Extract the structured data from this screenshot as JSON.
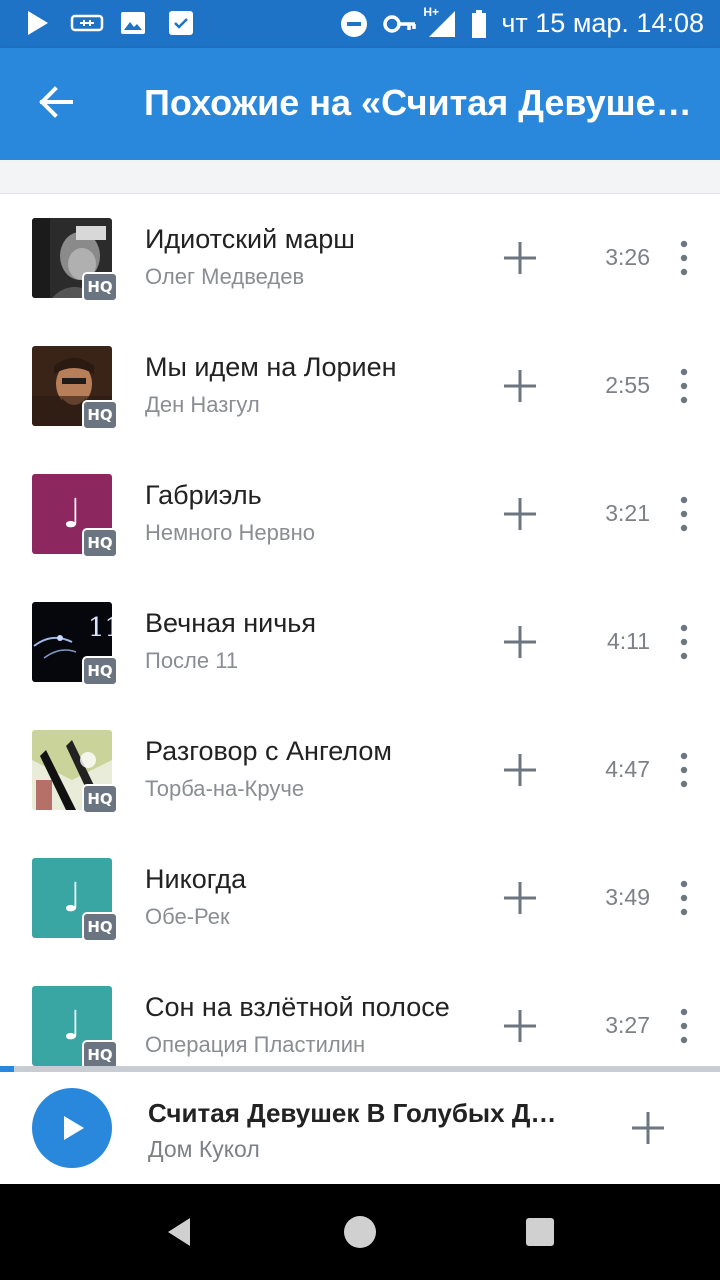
{
  "status_bar": {
    "date_time": "чт 15 мар. 14:08",
    "network": "H+",
    "icons": [
      "play-icon",
      "vpn-icon",
      "image-icon",
      "check-icon",
      "dnd-icon",
      "key-icon",
      "signal-icon",
      "battery-icon"
    ]
  },
  "app_bar": {
    "title": "Похожие на «Считая Девушек В Голубых Джинсах»",
    "back_icon": "back-arrow-icon",
    "background": "#2a88dc"
  },
  "tracks": [
    {
      "title": "Идиотский марш",
      "artist": "Олег Медведев",
      "duration": "3:26",
      "badge": "HQ",
      "cover": "photo"
    },
    {
      "title": "Мы идем на Лориен",
      "artist": "Ден Назгул",
      "duration": "2:55",
      "badge": "HQ",
      "cover": "photo"
    },
    {
      "title": "Габриэль",
      "artist": "Немного Нервно",
      "duration": "3:21",
      "badge": "HQ",
      "cover": "note",
      "cover_color": "#8d2760"
    },
    {
      "title": "Вечная ничья",
      "artist": "После 11",
      "duration": "4:11",
      "badge": "HQ",
      "cover": "photo"
    },
    {
      "title": "Разговор с Ангелом",
      "artist": "Торба-на-Круче",
      "duration": "4:47",
      "badge": "HQ",
      "cover": "photo"
    },
    {
      "title": "Никогда",
      "artist": "Обе-Рек",
      "duration": "3:49",
      "badge": "HQ",
      "cover": "note",
      "cover_color": "#3aa6a3"
    },
    {
      "title": "Сон на взлётной полосе",
      "artist": "Операция Пластилин",
      "duration": "3:27",
      "badge": "HQ",
      "cover": "note",
      "cover_color": "#3aa6a3"
    }
  ],
  "player": {
    "title": "Считая Девушек В Голубых Джинсах",
    "artist": "Дом Кукол",
    "progress": 0.02
  },
  "colors": {
    "accent": "#2a88dc",
    "status_bar": "#1f73c6"
  }
}
